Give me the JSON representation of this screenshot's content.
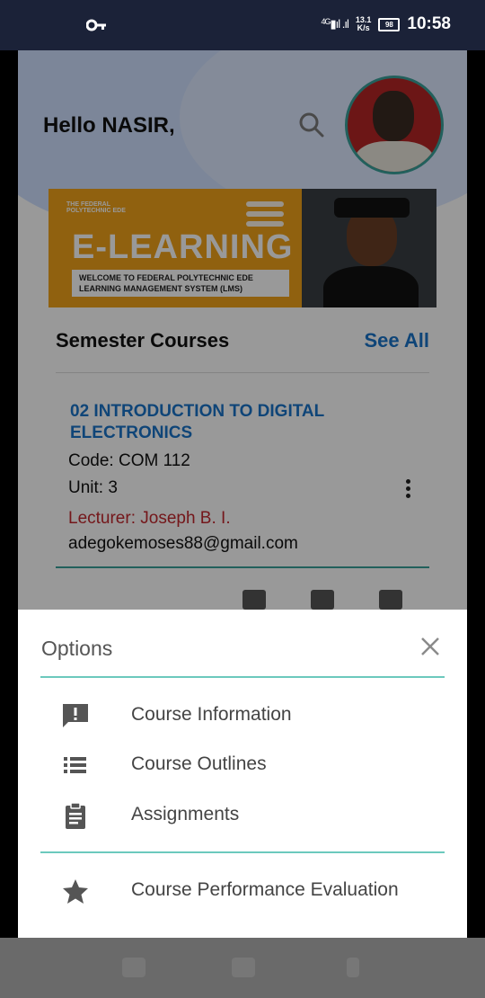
{
  "status_bar": {
    "key_icon": "key-icon",
    "network": "4G",
    "speed_value": "13.1",
    "speed_unit": "K/s",
    "battery": "98",
    "time": "10:58"
  },
  "home": {
    "greeting": "Hello NASIR,",
    "search_icon": "search-icon",
    "banner": {
      "small_text": "THE FEDERAL POLYTECHNIC EDE",
      "title": "E-LEARNING",
      "welcome": "WELCOME TO FEDERAL POLYTECHNIC EDE LEARNING MANAGEMENT SYSTEM (LMS)"
    },
    "section_title": "Semester Courses",
    "see_all": "See All",
    "course": {
      "title": "02 INTRODUCTION TO DIGITAL ELECTRONICS",
      "code": "Code: COM 112",
      "unit": "Unit: 3",
      "lecturer": "Lecturer: Joseph B. I.",
      "email": "adegokemoses88@gmail.com"
    }
  },
  "sheet": {
    "title": "Options",
    "options": [
      {
        "label": "Course Information",
        "icon": "alert-message-icon"
      },
      {
        "label": "Course Outlines",
        "icon": "list-icon"
      },
      {
        "label": "Assignments",
        "icon": "clipboard-icon"
      },
      {
        "label": "Course Performance Evaluation",
        "icon": "star-icon"
      }
    ]
  },
  "colors": {
    "accent_blue": "#1a73c8",
    "teal": "#3aa19a",
    "lecturer_red": "#c2272d",
    "status_bar": "#1b2238"
  }
}
